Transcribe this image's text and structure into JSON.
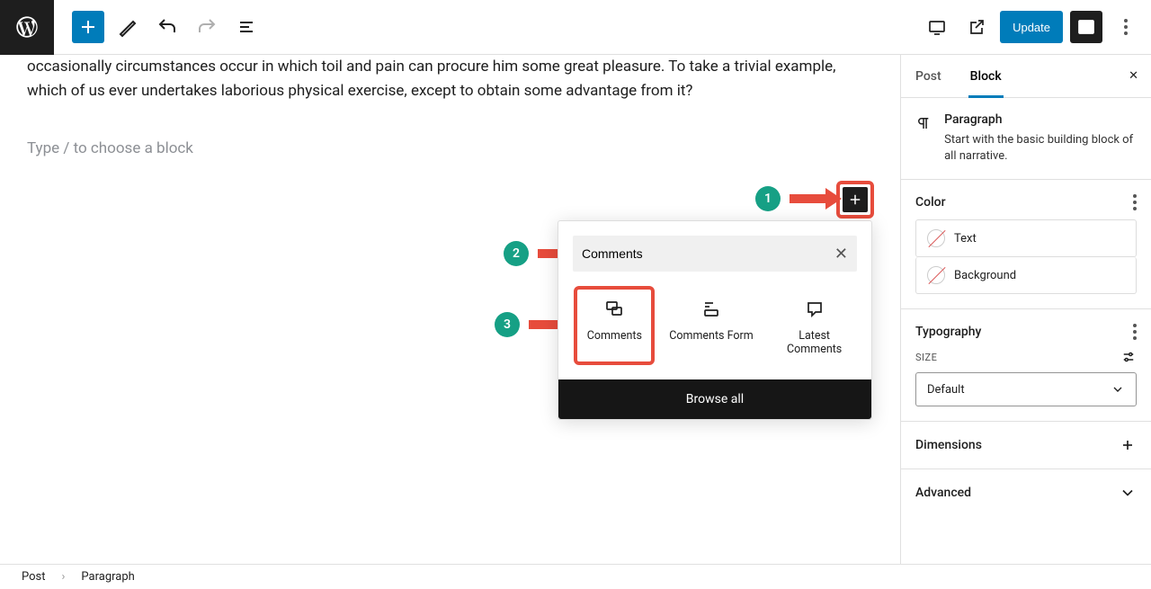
{
  "topbar": {
    "update_label": "Update"
  },
  "content": {
    "paragraph": "occasionally circumstances occur in which toil and pain can procure him some great pleasure. To take a trivial example, which of us ever undertakes laborious physical exercise, except to obtain some advantage from it?",
    "placeholder": "Type / to choose a block"
  },
  "annotations": {
    "n1": "1",
    "n2": "2",
    "n3": "3"
  },
  "inserter": {
    "search_value": "Comments",
    "items": [
      {
        "label": "Comments"
      },
      {
        "label": "Comments Form"
      },
      {
        "label": "Latest Comments"
      }
    ],
    "browse_all": "Browse all"
  },
  "sidebar": {
    "tabs": {
      "post": "Post",
      "block": "Block"
    },
    "block_info": {
      "title": "Paragraph",
      "description": "Start with the basic building block of all narrative."
    },
    "color": {
      "heading": "Color",
      "text": "Text",
      "background": "Background"
    },
    "typography": {
      "heading": "Typography",
      "size_label": "SIZE",
      "size_value": "Default"
    },
    "dimensions": {
      "heading": "Dimensions"
    },
    "advanced": {
      "heading": "Advanced"
    }
  },
  "breadcrumb": {
    "post": "Post",
    "paragraph": "Paragraph"
  }
}
